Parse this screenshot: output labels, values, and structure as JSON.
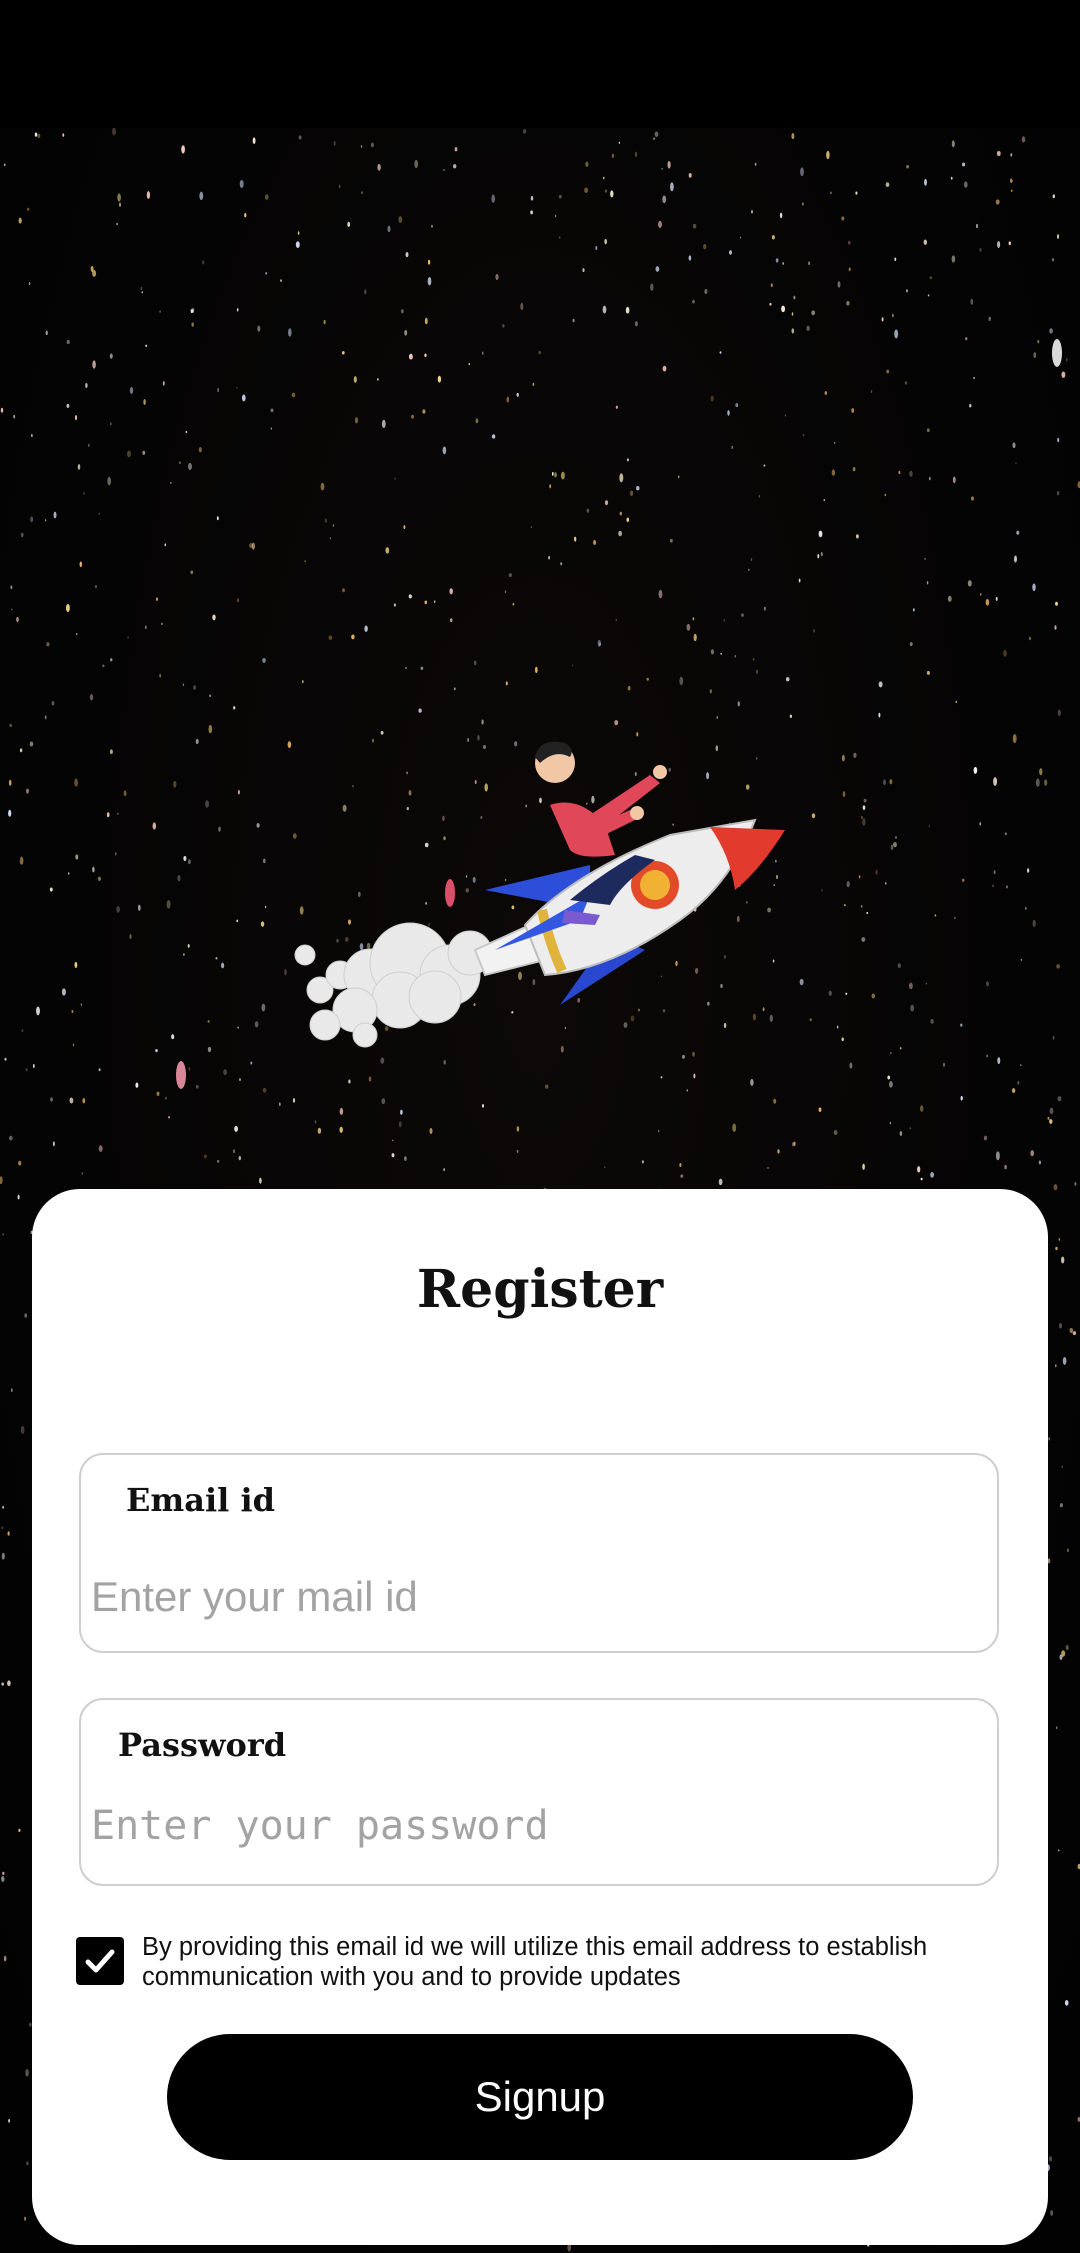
{
  "register": {
    "title": "Register",
    "email": {
      "label": "Email id",
      "value": "",
      "placeholder": "Enter your mail id"
    },
    "password": {
      "label": "Password",
      "value": "",
      "placeholder": "Enter your password"
    },
    "consent": {
      "checked": true,
      "text": "By providing this email id we will utilize this email address to establish communication with you and to provide updates"
    },
    "signup_label": "Signup"
  },
  "colors": {
    "background": "#000000",
    "card": "#ffffff",
    "button": "#000000",
    "button_text": "#ffffff",
    "placeholder": "#a3a3a3"
  },
  "icons": {
    "checkbox": "checkmark-icon",
    "hero": "rocket-illustration"
  }
}
